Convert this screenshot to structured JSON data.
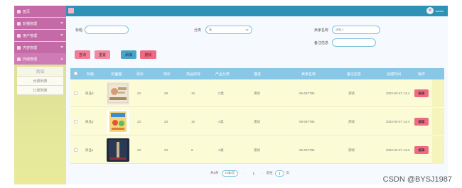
{
  "sidebar": {
    "home": "首页",
    "menus": [
      "轮播管理",
      "用户管理",
      "内容管理",
      "商城管理"
    ],
    "sub_title": "商城",
    "sub_links": [
      "分类列表",
      "订单列表"
    ]
  },
  "topbar": {
    "user": "admin"
  },
  "filters": {
    "title_label": "标题",
    "category_label": "分类",
    "category_value": "无",
    "seller_label": "卖家名称",
    "seller_placeholder": "请输入",
    "remark_label": "备注信息"
  },
  "buttons": {
    "search": "查询",
    "reset": "重置",
    "add": "添加",
    "delete": "删除"
  },
  "table": {
    "headers": [
      "标题",
      "封面图",
      "原价",
      "现价",
      "商品库存",
      "产品分类",
      "描述",
      "卖家名称",
      "备注信息",
      "创建时间",
      "操作"
    ],
    "rows": [
      {
        "title": "商品3",
        "orig": "23",
        "price": "28",
        "stock": "10",
        "category": "C类",
        "desc": "测试",
        "seller": "06-067786",
        "remark": "测试",
        "created": "2022-02-27 14:4",
        "action": "编辑"
      },
      {
        "title": "商品2",
        "orig": "23",
        "price": "23",
        "stock": "10",
        "category": "A类",
        "desc": "测试",
        "seller": "06-067786",
        "remark": "测试",
        "created": "2022-02-27 14:4",
        "action": "编辑"
      },
      {
        "title": "商品1",
        "orig": "23",
        "price": "23",
        "stock": "9",
        "category": "A类",
        "desc": "测试",
        "seller": "06-067786",
        "remark": "测试",
        "created": "2022-02-27 14:3",
        "action": "编辑"
      }
    ]
  },
  "pager": {
    "total": "共3条",
    "page_size": "10条/页",
    "current": "1",
    "goto_prefix": "前往",
    "goto_value": "1",
    "goto_suffix": "页"
  },
  "watermark": "CSDN @BYSJ1987"
}
